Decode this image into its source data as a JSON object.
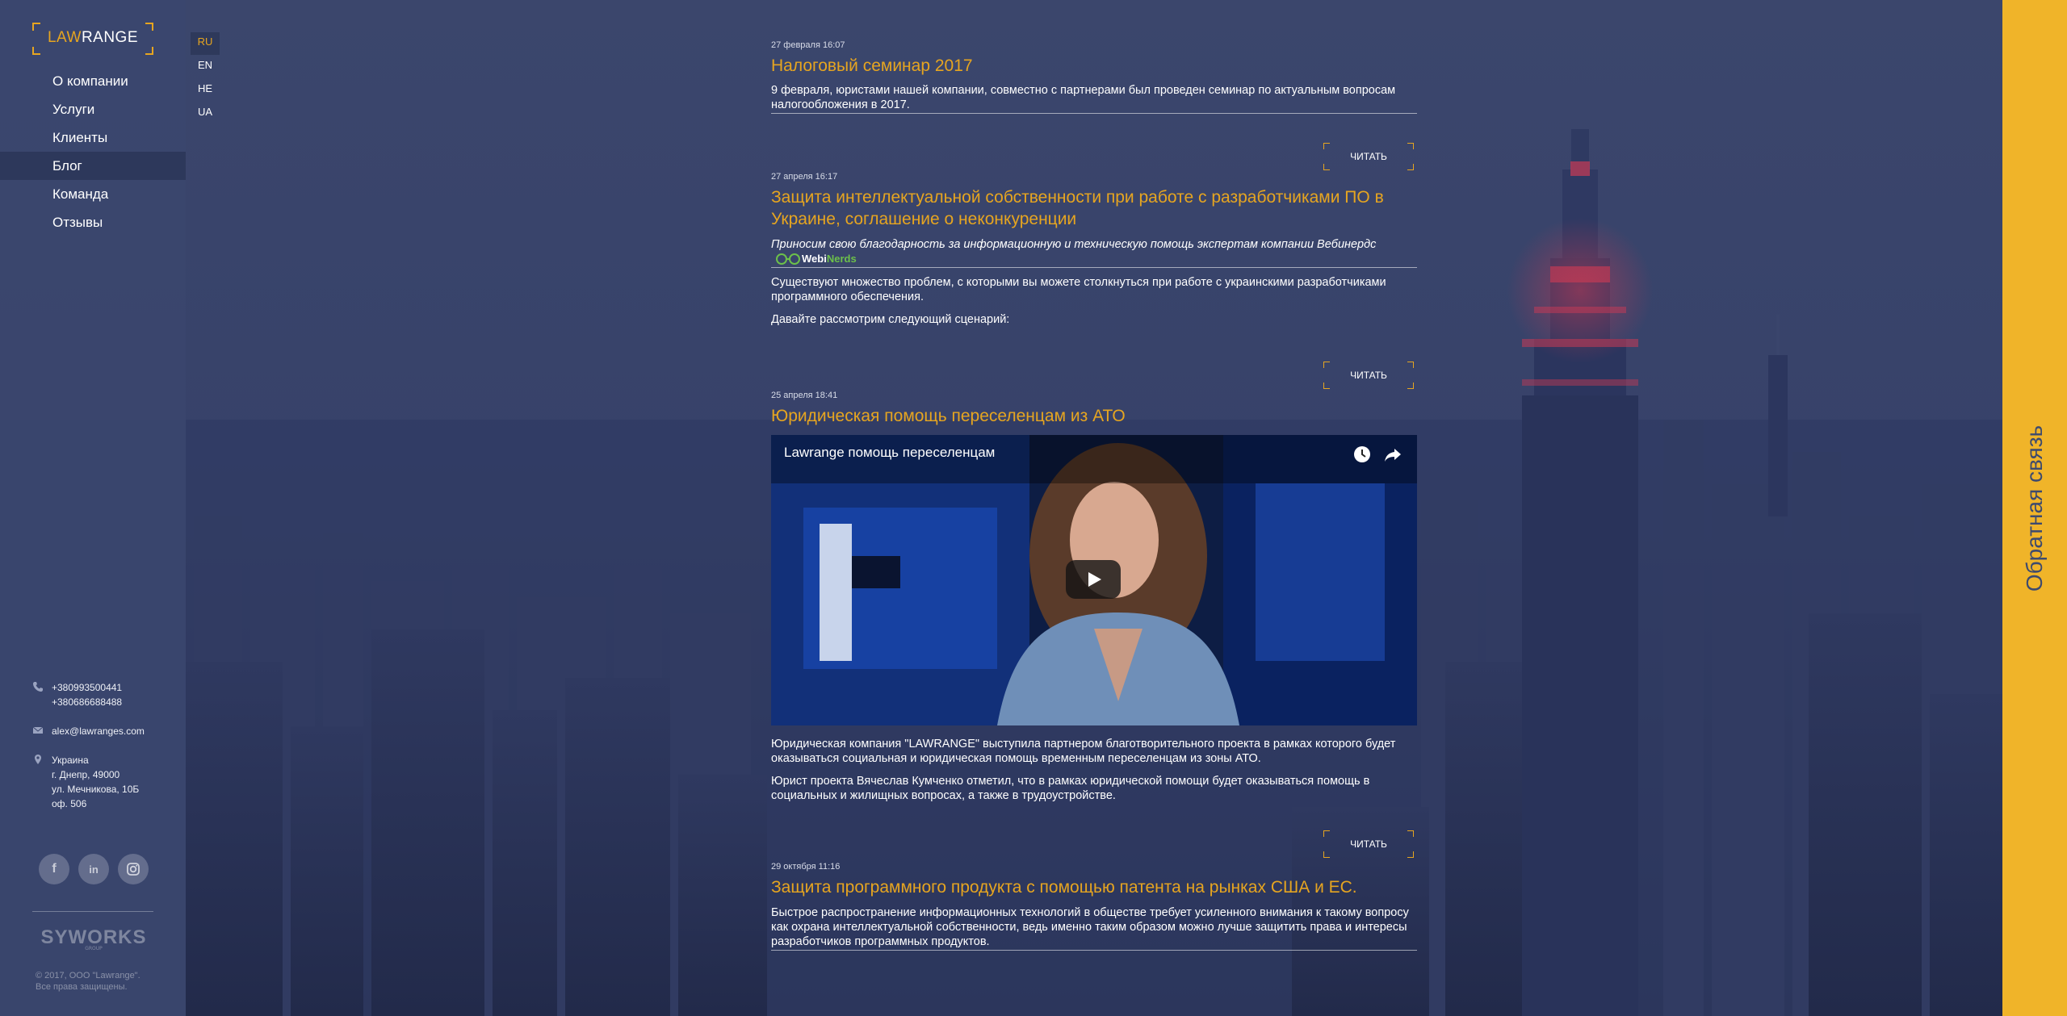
{
  "brand": {
    "logo_law": "LAW",
    "logo_range": "RANGE"
  },
  "nav": {
    "items": [
      {
        "label": "О компании"
      },
      {
        "label": "Услуги"
      },
      {
        "label": "Клиенты"
      },
      {
        "label": "Блог",
        "active": true
      },
      {
        "label": "Команда"
      },
      {
        "label": "Отзывы"
      }
    ]
  },
  "langs": {
    "items": [
      {
        "label": "RU",
        "active": true
      },
      {
        "label": "EN"
      },
      {
        "label": "HE"
      },
      {
        "label": "UA"
      }
    ]
  },
  "contacts": {
    "phone1": "+380993500441",
    "phone2": "+380686688488",
    "email": "alex@lawranges.com",
    "address": [
      "Украина",
      "г. Днепр, 49000",
      "ул. Мечникова, 10Б",
      "оф. 506"
    ]
  },
  "socials": {
    "facebook": "f",
    "linkedin": "in",
    "instagram": "ig"
  },
  "footer": {
    "syworks": "SYWORKS",
    "syworks_sub": "GROUP",
    "copyright_1": "© 2017, ООО \"Lawrange\".",
    "copyright_2": "Все права защищены."
  },
  "posts": [
    {
      "date": "27 февраля 16:07",
      "title": "Налоговый семинар 2017",
      "text": "9 февраля, юристами нашей компании, совместно с партнерами был проведен семинар по актуальным вопросам налогообложения в 2017.",
      "read": "ЧИТАТЬ"
    },
    {
      "date": "27 апреля 16:17",
      "title": "Защита интеллектуальной собственности при работе с разработчиками ПО в Украине, соглашение о неконкуренции",
      "italic": "Приносим свою благодарность за информационную и техническую помощь экспертам компании Вебинердс",
      "webinerds_a": "Webi",
      "webinerds_b": "Nerds",
      "text1": "Существуют множество проблем, с которыми вы можете столкнуться при работе с украинскими разработчиками программного обеспечения.",
      "text2": "Давайте рассмотрим следующий сценарий:",
      "read": "ЧИТАТЬ"
    },
    {
      "date": "25 апреля 18:41",
      "title": "Юридическая помощь переселенцам из АТО",
      "video_title": "Lawrange помощь переселенцам",
      "text1": "Юридическая компания \"LAWRANGE\" выступила партнером благотворительного проекта в рамках которого будет оказываться социальная и юридическая помощь временным переселенцам из зоны АТО.",
      "text2": "Юрист проекта Вячеслав Кумченко отметил, что в рамках юридической помощи будет оказываться помощь в социальных и жилищных вопросах, а также в трудоустройстве.",
      "read": "ЧИТАТЬ"
    },
    {
      "date": "29 октября 11:16",
      "title": "Защита программного продукта с помощью патента на рынках США и ЕС.",
      "text": "Быстрое распространение информационных технологий в обществе требует усиленного внимания к такому вопросу как охрана интеллектуальной собственности, ведь именно таким образом можно лучше защитить права и интересы разработчиков программных продуктов."
    }
  ],
  "feedback": {
    "label": "Обратная связь"
  },
  "colors": {
    "accent": "#e6a520",
    "feedback_bg": "#f0b429",
    "sidebar_bg": "#3a466e"
  }
}
